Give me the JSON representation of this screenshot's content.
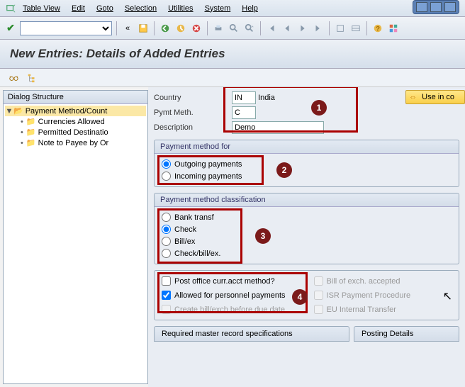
{
  "menu": {
    "tableview": "Table View",
    "edit": "Edit",
    "goto": "Goto",
    "selection": "Selection",
    "utilities": "Utilities",
    "system": "System",
    "help": "Help"
  },
  "title": "New Entries: Details of Added Entries",
  "tree": {
    "header": "Dialog Structure",
    "root": "Payment Method/Count",
    "n1": "Currencies Allowed",
    "n2": "Permitted Destinatio",
    "n3": "Note to Payee by Or"
  },
  "fields": {
    "country_lbl": "Country",
    "country_val": "IN",
    "country_name": "India",
    "pymt_lbl": "Pymt Meth.",
    "pymt_val": "C",
    "desc_lbl": "Description",
    "desc_val": "Demo"
  },
  "usebtn": "Use in co",
  "grp1": {
    "hd": "Payment method for",
    "o1": "Outgoing payments",
    "o2": "Incoming payments"
  },
  "grp2": {
    "hd": "Payment method classification",
    "o1": "Bank transf",
    "o2": "Check",
    "o3": "Bill/ex",
    "o4": "Check/bill/ex."
  },
  "grp3": {
    "c1": "Post office curr.acct method?",
    "c2": "Allowed for personnel payments",
    "c3": "Create bill/exch.before due date",
    "r1": "Bill of exch. accepted",
    "r2": "ISR Payment Procedure",
    "r3": "EU Internal Transfer"
  },
  "tabs": {
    "t1": "Required master record specifications",
    "t2": "Posting Details"
  },
  "badges": {
    "b1": "1",
    "b2": "2",
    "b3": "3",
    "b4": "4"
  }
}
